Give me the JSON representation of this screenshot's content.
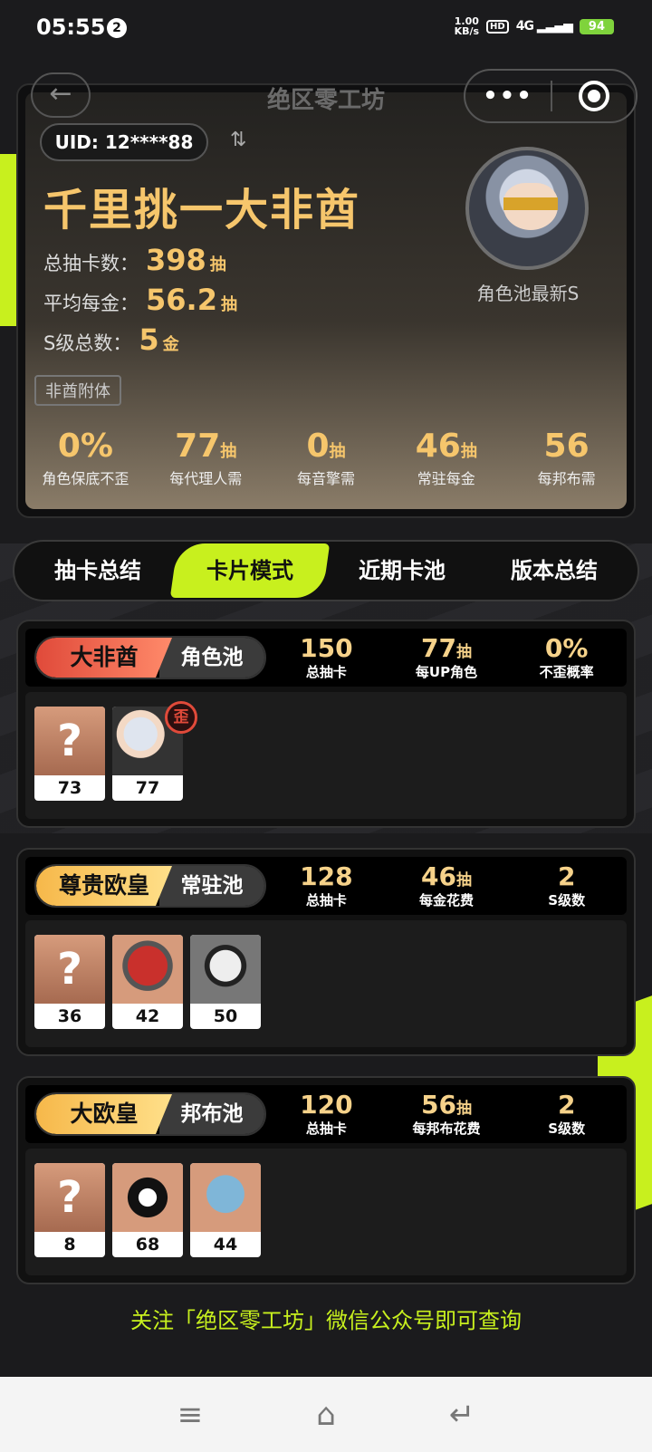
{
  "status": {
    "time": "05:55",
    "notif_count": "2",
    "speed_value": "1.00",
    "speed_unit": "KB/s",
    "hd": "HD",
    "network": "4G",
    "battery": "94"
  },
  "nav": {
    "back_icon": "arrow-left-icon",
    "title": "绝区零工坊",
    "more_label": "•••"
  },
  "profile": {
    "uid": "UID: 12****88",
    "title": "千里挑一大非酋",
    "stats": [
      {
        "label": "总抽卡数：",
        "value": "398",
        "unit": "抽"
      },
      {
        "label": "平均每金：",
        "value": "56.2",
        "unit": "抽"
      },
      {
        "label": "S级总数：",
        "value": "5",
        "unit": "金"
      }
    ],
    "tag": "非酋附体",
    "avatar_label": "角色池最新S"
  },
  "kpis": [
    {
      "value": "0%",
      "unit": "",
      "label": "角色保底不歪"
    },
    {
      "value": "77",
      "unit": "抽",
      "label": "每代理人需"
    },
    {
      "value": "0",
      "unit": "抽",
      "label": "每音擎需"
    },
    {
      "value": "46",
      "unit": "抽",
      "label": "常驻每金"
    },
    {
      "value": "56",
      "unit": "",
      "label": "每邦布需"
    }
  ],
  "tabs": [
    {
      "label": "抽卡总结",
      "active": false
    },
    {
      "label": "卡片模式",
      "active": true
    },
    {
      "label": "近期卡池",
      "active": false
    },
    {
      "label": "版本总结",
      "active": false
    }
  ],
  "pools": [
    {
      "rank": "大非酋",
      "pool": "角色池",
      "stats": [
        {
          "value": "150",
          "unit": "",
          "label": "总抽卡"
        },
        {
          "value": "77",
          "unit": "抽",
          "label": "每UP角色"
        },
        {
          "value": "0%",
          "unit": "",
          "label": "不歪概率"
        }
      ],
      "cards": [
        {
          "num": "73",
          "mystery": "?"
        },
        {
          "num": "77"
        }
      ],
      "wai": "歪"
    },
    {
      "rank": "尊贵欧皇",
      "pool": "常驻池",
      "stats": [
        {
          "value": "128",
          "unit": "",
          "label": "总抽卡"
        },
        {
          "value": "46",
          "unit": "抽",
          "label": "每金花费"
        },
        {
          "value": "2",
          "unit": "",
          "label": "S级数"
        }
      ],
      "cards": [
        {
          "num": "36",
          "mystery": "?"
        },
        {
          "num": "42"
        },
        {
          "num": "50"
        }
      ]
    },
    {
      "rank": "大欧皇",
      "pool": "邦布池",
      "stats": [
        {
          "value": "120",
          "unit": "",
          "label": "总抽卡"
        },
        {
          "value": "56",
          "unit": "抽",
          "label": "每邦布花费"
        },
        {
          "value": "2",
          "unit": "",
          "label": "S级数"
        }
      ],
      "cards": [
        {
          "num": "8",
          "mystery": "?"
        },
        {
          "num": "68"
        },
        {
          "num": "44"
        }
      ]
    }
  ],
  "footer": "关注「绝区零工坊」微信公众号即可查询",
  "colors": {
    "accent": "#c8f01e",
    "gold": "#f6c66c",
    "red": "#e04a3a"
  }
}
